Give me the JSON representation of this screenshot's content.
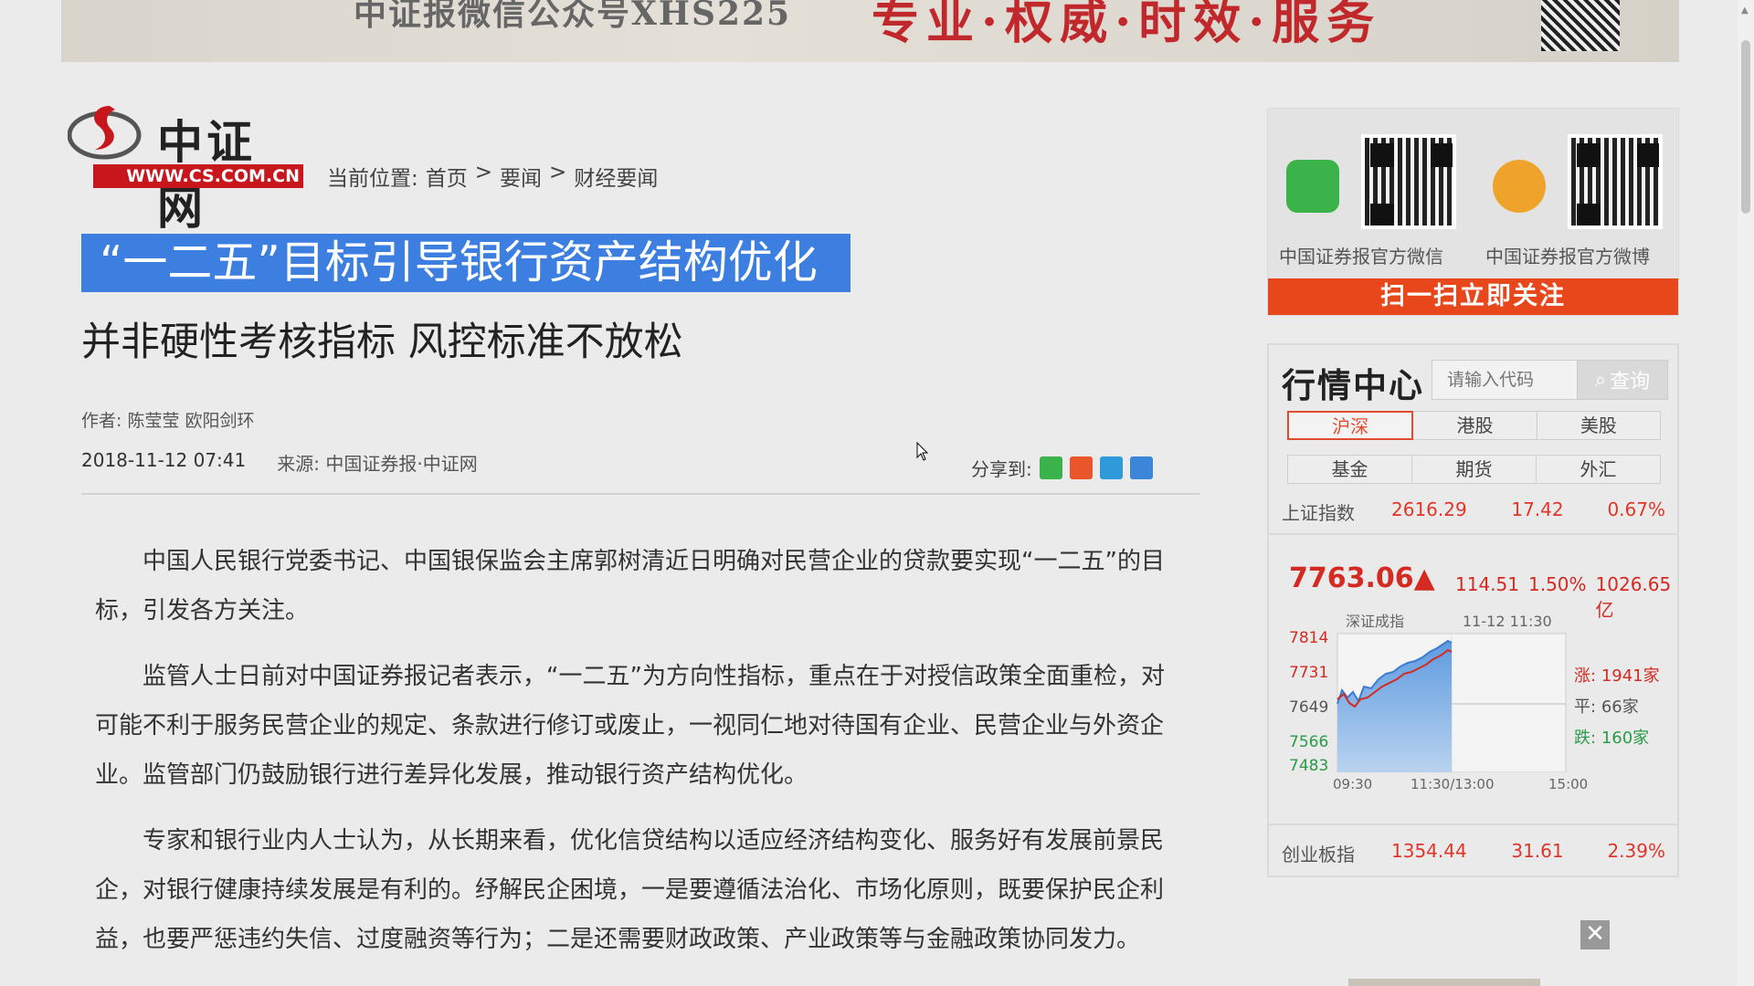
{
  "banner": {
    "left_text": "中证报微信公众号XHS225",
    "right_text": "专业·权威·时效·服务"
  },
  "header": {
    "logo_cn": "中证网",
    "logo_url": "WWW.CS.COM.CN",
    "breadcrumb": {
      "label": "当前位置:",
      "items": [
        "首页",
        "要闻",
        "财经要闻"
      ],
      "sep": ">"
    }
  },
  "article": {
    "title": "“一二五”目标引导银行资产结构优化",
    "subtitle": "并非硬性考核指标 风控标准不放松",
    "author_label": "作者:",
    "author": "陈莹莹 欧阳剑环",
    "date": "2018-11-12 07:41",
    "source_label": "来源:",
    "source": "中国证券报·中证网",
    "share_label": "分享到:",
    "paragraphs": [
      "中国人民银行党委书记、中国银保监会主席郭树清近日明确对民营企业的贷款要实现“一二五”的目标，引发各方关注。",
      "监管人士日前对中国证券报记者表示，“一二五”为方向性指标，重点在于对授信政策全面重检，对可能不利于服务民营企业的规定、条款进行修订或废止，一视同仁地对待国有企业、民营企业与外资企业。监管部门仍鼓励银行进行差异化发展，推动银行资产结构优化。",
      "专家和银行业内人士认为，从长期来看，优化信贷结构以适应经济结构变化、服务好有发展前景民企，对银行健康持续发展是有利的。纾解民企困境，一是要遵循法治化、市场化原则，既要保护民企利益，也要严惩违约失信、过度融资等行为；二是还需要财政政策、产业政策等与金融政策协同发力。"
    ]
  },
  "follow": {
    "wechat_caption": "中国证券报官方微信",
    "weibo_caption": "中国证券报官方微博",
    "bar": "扫一扫立即关注"
  },
  "market": {
    "title": "行情中心",
    "search_placeholder": "请输入代码",
    "search_button": "查询",
    "tabs_row1": [
      "沪深",
      "港股",
      "美股"
    ],
    "tabs_row2": [
      "基金",
      "期货",
      "外汇"
    ],
    "sh_index": {
      "name": "上证指数",
      "value": "2616.29",
      "change": "17.42",
      "pct": "0.67%"
    },
    "sz_price": "7763.06▲",
    "sz_change": "114.51",
    "sz_pct": "1.50%",
    "sz_amount": "1026.65亿",
    "chart_name": "深证成指",
    "chart_time": "11-12 11:30",
    "y_ticks": [
      "7814",
      "7731",
      "7649",
      "7566",
      "7483"
    ],
    "x_ticks": [
      "09:30",
      "11:30/13:00",
      "15:00"
    ],
    "up_label": "涨:",
    "up_value": "1941家",
    "flat_label": "平:",
    "flat_value": "66家",
    "down_label": "跌:",
    "down_value": "160家",
    "cyb": {
      "name": "创业板指",
      "value": "1354.44",
      "change": "31.61",
      "pct": "2.39%"
    }
  },
  "ad": {
    "close": "✕"
  },
  "colors": {
    "accent_red": "#c8161d",
    "selection_blue": "#3c7fe0",
    "up_red": "#d42a22",
    "down_green": "#2a9b46"
  }
}
